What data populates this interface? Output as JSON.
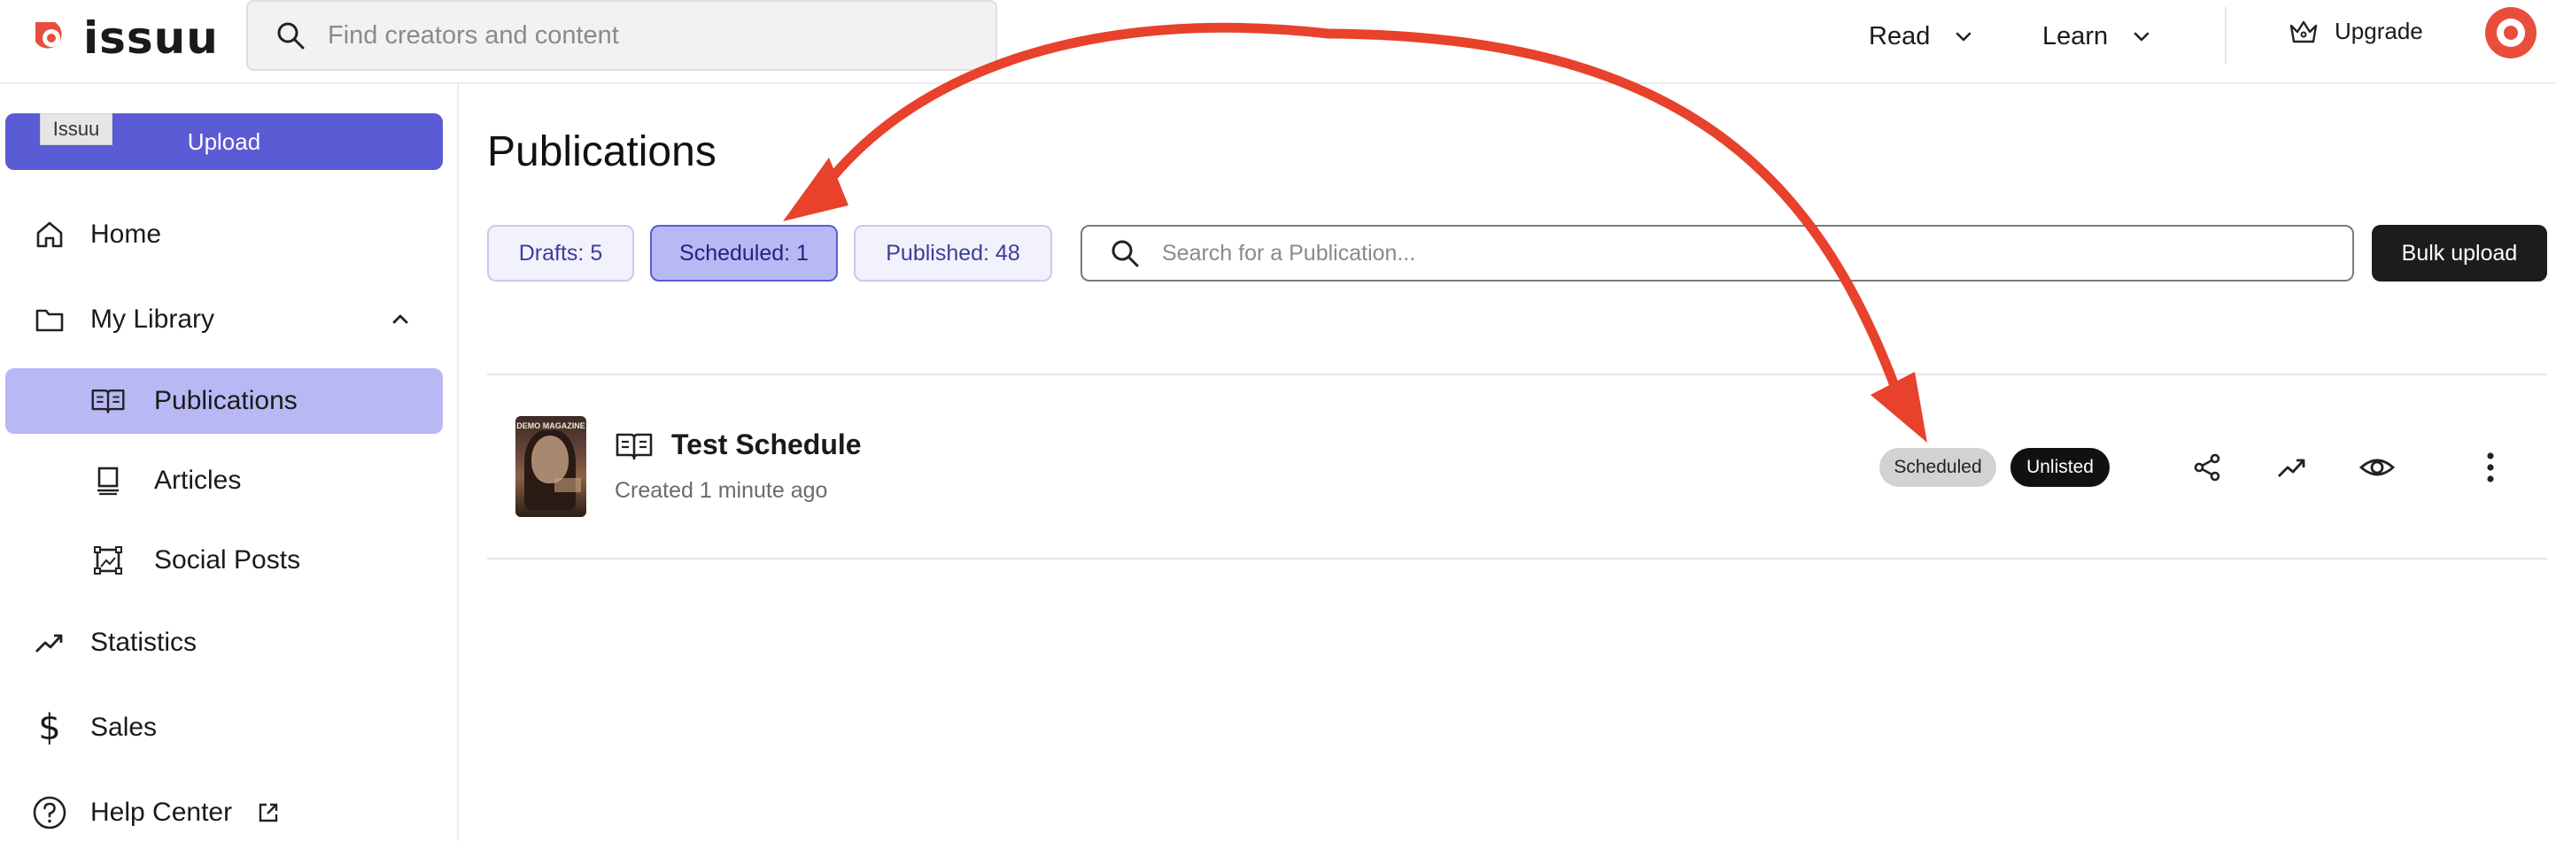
{
  "header": {
    "logo_text": "issuu",
    "search_placeholder": "Find creators and content",
    "nav": [
      {
        "label": "Read"
      },
      {
        "label": "Learn"
      }
    ],
    "upgrade_label": "Upgrade",
    "brand_color": "#e84e3b"
  },
  "sidebar": {
    "upload_label": "Upload",
    "tooltip": "Issuu",
    "items": [
      {
        "label": "Home",
        "icon": "home-icon"
      },
      {
        "label": "My Library",
        "icon": "folder-icon"
      },
      {
        "label": "Publications",
        "icon": "book-open-icon",
        "active": true
      },
      {
        "label": "Articles",
        "icon": "article-icon"
      },
      {
        "label": "Social Posts",
        "icon": "image-frame-icon"
      },
      {
        "label": "Statistics",
        "icon": "trending-up-icon"
      },
      {
        "label": "Sales",
        "icon": "dollar-icon"
      },
      {
        "label": "Help Center",
        "icon": "help-circle-icon"
      }
    ],
    "accent_color": "#5b5bd6",
    "active_bg": "#b8b8f5"
  },
  "main": {
    "title": "Publications",
    "filters": [
      {
        "label": "Drafts: 5"
      },
      {
        "label": "Scheduled: 1",
        "active": true
      },
      {
        "label": "Published: 48"
      }
    ],
    "search_placeholder": "Search for a Publication...",
    "bulk_upload_label": "Bulk upload",
    "publication": {
      "cover_title": "DEMO MAGAZINE",
      "title": "Test Schedule",
      "created": "Created 1 minute ago",
      "badges": [
        "Scheduled",
        "Unlisted"
      ],
      "actions": [
        "share-icon",
        "statistics-icon",
        "preview-eye-icon",
        "more-vertical-icon"
      ]
    }
  },
  "annotation_color": "#e8412c"
}
